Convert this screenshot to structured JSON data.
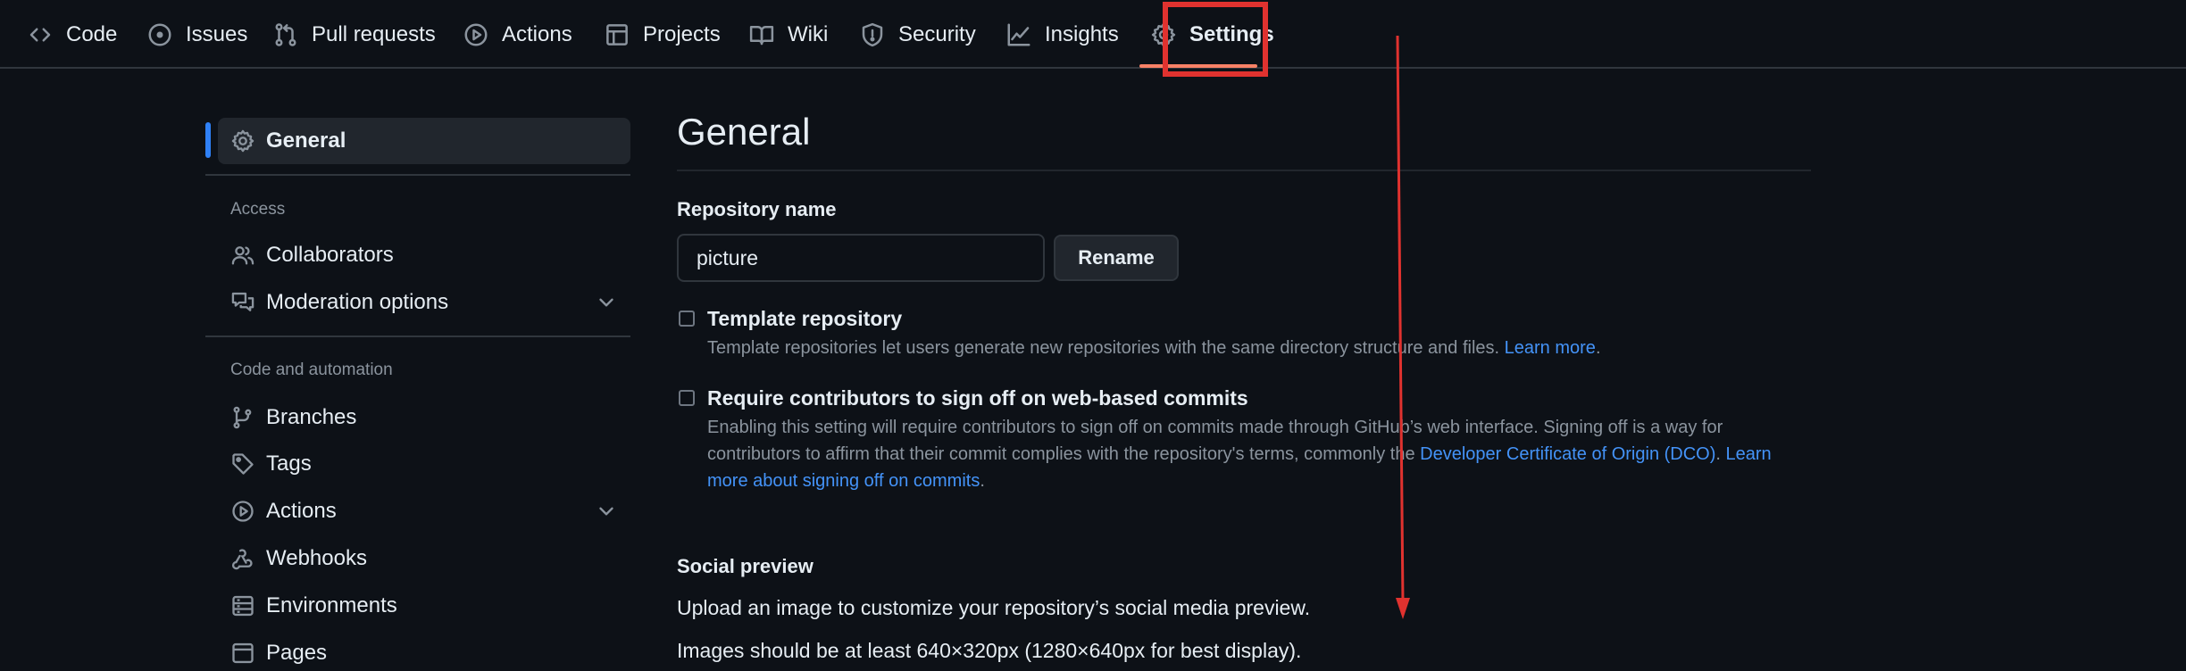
{
  "repo_nav": {
    "tabs": [
      {
        "label": "Code",
        "icon": "code-icon"
      },
      {
        "label": "Issues",
        "icon": "issue-opened-icon"
      },
      {
        "label": "Pull requests",
        "icon": "git-pull-request-icon"
      },
      {
        "label": "Actions",
        "icon": "play-icon"
      },
      {
        "label": "Projects",
        "icon": "table-icon"
      },
      {
        "label": "Wiki",
        "icon": "book-icon"
      },
      {
        "label": "Security",
        "icon": "shield-icon"
      },
      {
        "label": "Insights",
        "icon": "graph-icon"
      },
      {
        "label": "Settings",
        "icon": "gear-icon",
        "selected": true
      }
    ]
  },
  "sidebar": {
    "general": "General",
    "access_heading": "Access",
    "collaborators": "Collaborators",
    "moderation": "Moderation options",
    "automation_heading": "Code and automation",
    "branches": "Branches",
    "tags": "Tags",
    "actions": "Actions",
    "webhooks": "Webhooks",
    "environments": "Environments",
    "pages": "Pages"
  },
  "main": {
    "title": "General",
    "repo_name_label": "Repository name",
    "repo_name_value": "picture",
    "rename_button": "Rename",
    "template": {
      "title": "Template repository",
      "desc": "Template repositories let users generate new repositories with the same directory structure and files.",
      "link": "Learn more",
      "checked": false
    },
    "signoff": {
      "title": "Require contributors to sign off on web-based commits",
      "desc_part1": "Enabling this setting will require contributors to sign off on commits made through GitHub’s web interface. Signing off is a way for contributors to affirm that their commit complies with the repository's terms, commonly the",
      "dco_link": "Developer Certificate of Origin (DCO)",
      "learn_link": "Learn more about signing off on commits",
      "checked": false
    },
    "social_preview": {
      "title": "Social preview",
      "text": "Upload an image to customize your repository’s social media preview.",
      "size_note": "Images should be at least 640×320px (1280×640px for best display)."
    }
  },
  "colors": {
    "background": "#0d1117",
    "accent_blue": "#2f81f7",
    "link": "#4493f8",
    "tab_underline": "#f78166",
    "annotation_red": "#e0322f"
  }
}
